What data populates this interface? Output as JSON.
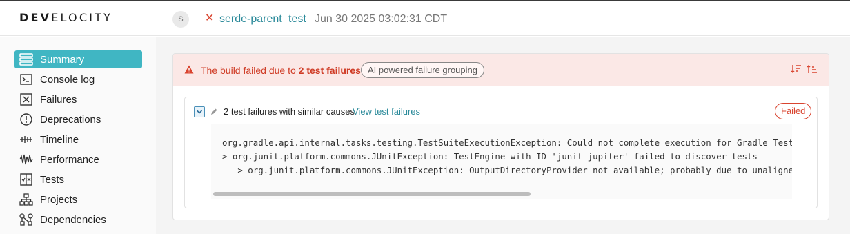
{
  "header": {
    "logo_bold": "DEV",
    "logo_rest": "ELOCITY",
    "avatar_letter": "S",
    "build_status": "✕",
    "project": "serde-parent",
    "task": "test",
    "timestamp": "Jun 30 2025 03:02:31 CDT"
  },
  "sidebar": {
    "items": [
      {
        "label": "Summary",
        "icon": "summary-icon",
        "active": true
      },
      {
        "label": "Console log",
        "icon": "console-icon"
      },
      {
        "label": "Failures",
        "icon": "failures-icon"
      },
      {
        "label": "Deprecations",
        "icon": "deprecations-icon"
      },
      {
        "label": "Timeline",
        "icon": "timeline-icon"
      },
      {
        "label": "Performance",
        "icon": "performance-icon"
      },
      {
        "label": "Tests",
        "icon": "tests-icon"
      },
      {
        "label": "Projects",
        "icon": "projects-icon"
      },
      {
        "label": "Dependencies",
        "icon": "dependencies-icon"
      }
    ]
  },
  "failure_banner": {
    "text_prefix": "The build failed due to ",
    "text_bold": "2 test failures",
    "ai_pill": "AI powered failure grouping",
    "colors": {
      "error": "#d9442f",
      "banner_bg": "#fbe8e6"
    }
  },
  "failure_group": {
    "title": "2 test failures with similar causes",
    "view_link": "View test failures",
    "badge": "Failed",
    "code_lines": [
      "org.gradle.api.internal.tasks.testing.TestSuiteExecutionException: Could not complete execution for Gradle Test Execut",
      "> org.junit.platform.commons.JUnitException: TestEngine with ID 'junit-jupiter' failed to discover tests",
      "   > org.junit.platform.commons.JUnitException: OutputDirectoryProvider not available; probably due to unaligned versi"
    ]
  },
  "colors": {
    "accent": "#40b6c3",
    "link": "#2b8a9a"
  }
}
